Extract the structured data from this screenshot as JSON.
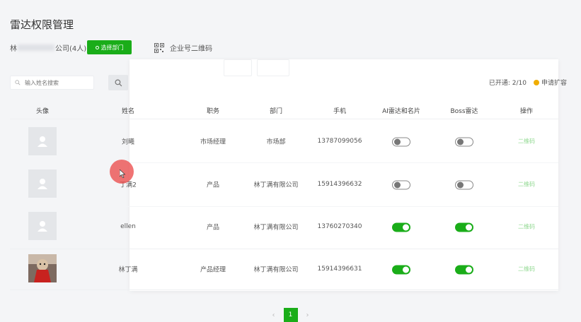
{
  "header": {
    "title": "雷达权限管理",
    "company_prefix": "林",
    "company_suffix": "公司(4人)",
    "select_dept_label": "选择部门",
    "qr_label": "企业号二维码"
  },
  "search": {
    "placeholder": "输入姓名搜索"
  },
  "status": {
    "opened": "已开通: 2/10",
    "expand": "申请扩容"
  },
  "table": {
    "headers": [
      "头像",
      "姓名",
      "职务",
      "部门",
      "手机",
      "AI雷达和名片",
      "Boss雷达",
      "操作"
    ],
    "rows": [
      {
        "name": "刘曦",
        "position": "市场经理",
        "dept": "市场部",
        "phone": "13787099056",
        "ai_radar": false,
        "boss_radar": false,
        "action": "二维码",
        "avatar": "placeholder"
      },
      {
        "name": "丁满2",
        "position": "产品",
        "dept": "林丁满有限公司",
        "phone": "15914396632",
        "ai_radar": false,
        "boss_radar": false,
        "action": "二维码",
        "avatar": "placeholder"
      },
      {
        "name": "ellen",
        "position": "产品",
        "dept": "林丁满有限公司",
        "phone": "13760270340",
        "ai_radar": true,
        "boss_radar": true,
        "action": "二维码",
        "avatar": "placeholder"
      },
      {
        "name": "林丁满",
        "position": "产品经理",
        "dept": "林丁满有限公司",
        "phone": "15914396631",
        "ai_radar": true,
        "boss_radar": true,
        "action": "二维码",
        "avatar": "photo"
      }
    ]
  },
  "pagination": {
    "prev": "‹",
    "current": "1",
    "next": "›"
  },
  "colors": {
    "accent": "#1aad19",
    "warn": "#f0ad00"
  }
}
